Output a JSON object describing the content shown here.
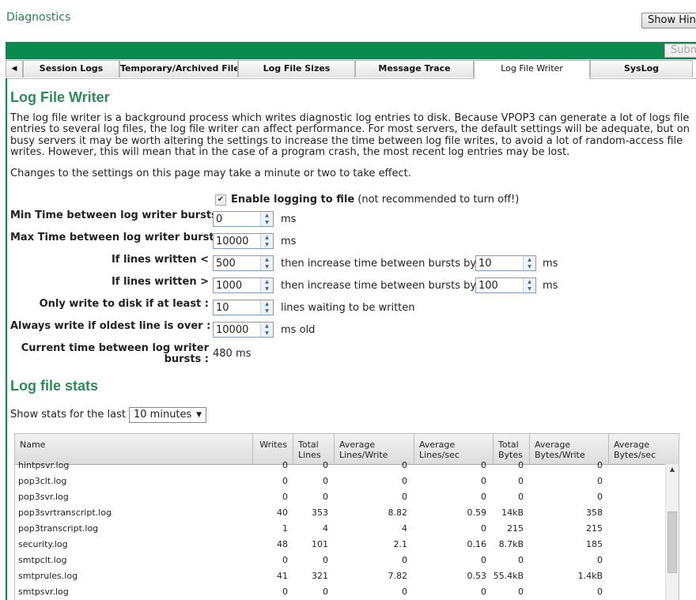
{
  "header": {
    "title": "Diagnostics",
    "show_hint_label": "Show Hint",
    "submit_label": "Submit"
  },
  "tabs": [
    {
      "label": "Session Logs"
    },
    {
      "label": "Temporary/Archived Files"
    },
    {
      "label": "Log File Sizes"
    },
    {
      "label": "Message Trace"
    },
    {
      "label": "Log File Writer"
    },
    {
      "label": "SysLog"
    }
  ],
  "log_file_writer": {
    "title": "Log File Writer",
    "intro": "The log file writer is a background process which writes diagnostic log entries to disk. Because VPOP3 can generate a lot of logs file entries to several log files, the log file writer can affect performance. For most servers, the default settings will be adequate, but on busy servers it may be worth altering the settings to increase the time between log file writes, to avoid a lot of random-access file writes. However, this will mean that in the case of a program crash, the most recent log entries may be lost.",
    "changes_note": "Changes to the settings on this page may take a minute or two to take effect.",
    "enable_label": "Enable logging to file",
    "enable_note": "(not recommended to turn off!)",
    "enable_checked": true,
    "min_label": "Min Time between log writer bursts :",
    "min_value": "0",
    "max_label": "Max Time between log writer bursts :",
    "max_value": "10000",
    "unit_ms": "ms",
    "lines_lt_label": "If lines written <",
    "lines_lt_value": "500",
    "lines_lt_increase": "10",
    "lines_gt_label": "If lines written >",
    "lines_gt_value": "1000",
    "lines_gt_increase": "100",
    "increase_text": "then increase time between bursts by",
    "only_write_label": "Only write to disk if at least :",
    "only_write_value": "10",
    "only_write_suffix": "lines waiting to be written",
    "always_write_label": "Always write if oldest line is over :",
    "always_write_value": "10000",
    "always_write_suffix": "ms old",
    "current_label_1": "Current time between log writer",
    "current_label_2": "bursts :",
    "current_value": "480 ms"
  },
  "stats": {
    "title": "Log file stats",
    "show_label": "Show stats for the last",
    "period": "10 minutes",
    "columns": [
      [
        "Name",
        ""
      ],
      [
        "Writes",
        ""
      ],
      [
        "Total",
        "Lines"
      ],
      [
        "Average",
        "Lines/Write"
      ],
      [
        "Average Lines/sec",
        ""
      ],
      [
        "Total",
        "Bytes"
      ],
      [
        "Average",
        "Bytes/Write"
      ],
      [
        "Average",
        "Bytes/sec"
      ]
    ],
    "rows": [
      [
        "hintpsvr.log",
        "0",
        "0",
        "0",
        "0",
        "0",
        "0"
      ],
      [
        "pop3clt.log",
        "0",
        "0",
        "0",
        "0",
        "0",
        "0"
      ],
      [
        "pop3svr.log",
        "0",
        "0",
        "0",
        "0",
        "0",
        "0"
      ],
      [
        "pop3svrtranscript.log",
        "40",
        "353",
        "8.82",
        "0.59",
        "14kB",
        "358"
      ],
      [
        "pop3transcript.log",
        "1",
        "4",
        "4",
        "0",
        "215",
        "215"
      ],
      [
        "security.log",
        "48",
        "101",
        "2.1",
        "0.16",
        "8.7kB",
        "185"
      ],
      [
        "smtpclt.log",
        "0",
        "0",
        "0",
        "0",
        "0",
        "0"
      ],
      [
        "smtprules.log",
        "41",
        "321",
        "7.82",
        "0.53",
        "55.4kB",
        "1.4kB"
      ],
      [
        "smtpsvr.log",
        "0",
        "0",
        "0",
        "0",
        "0",
        "0"
      ]
    ]
  }
}
